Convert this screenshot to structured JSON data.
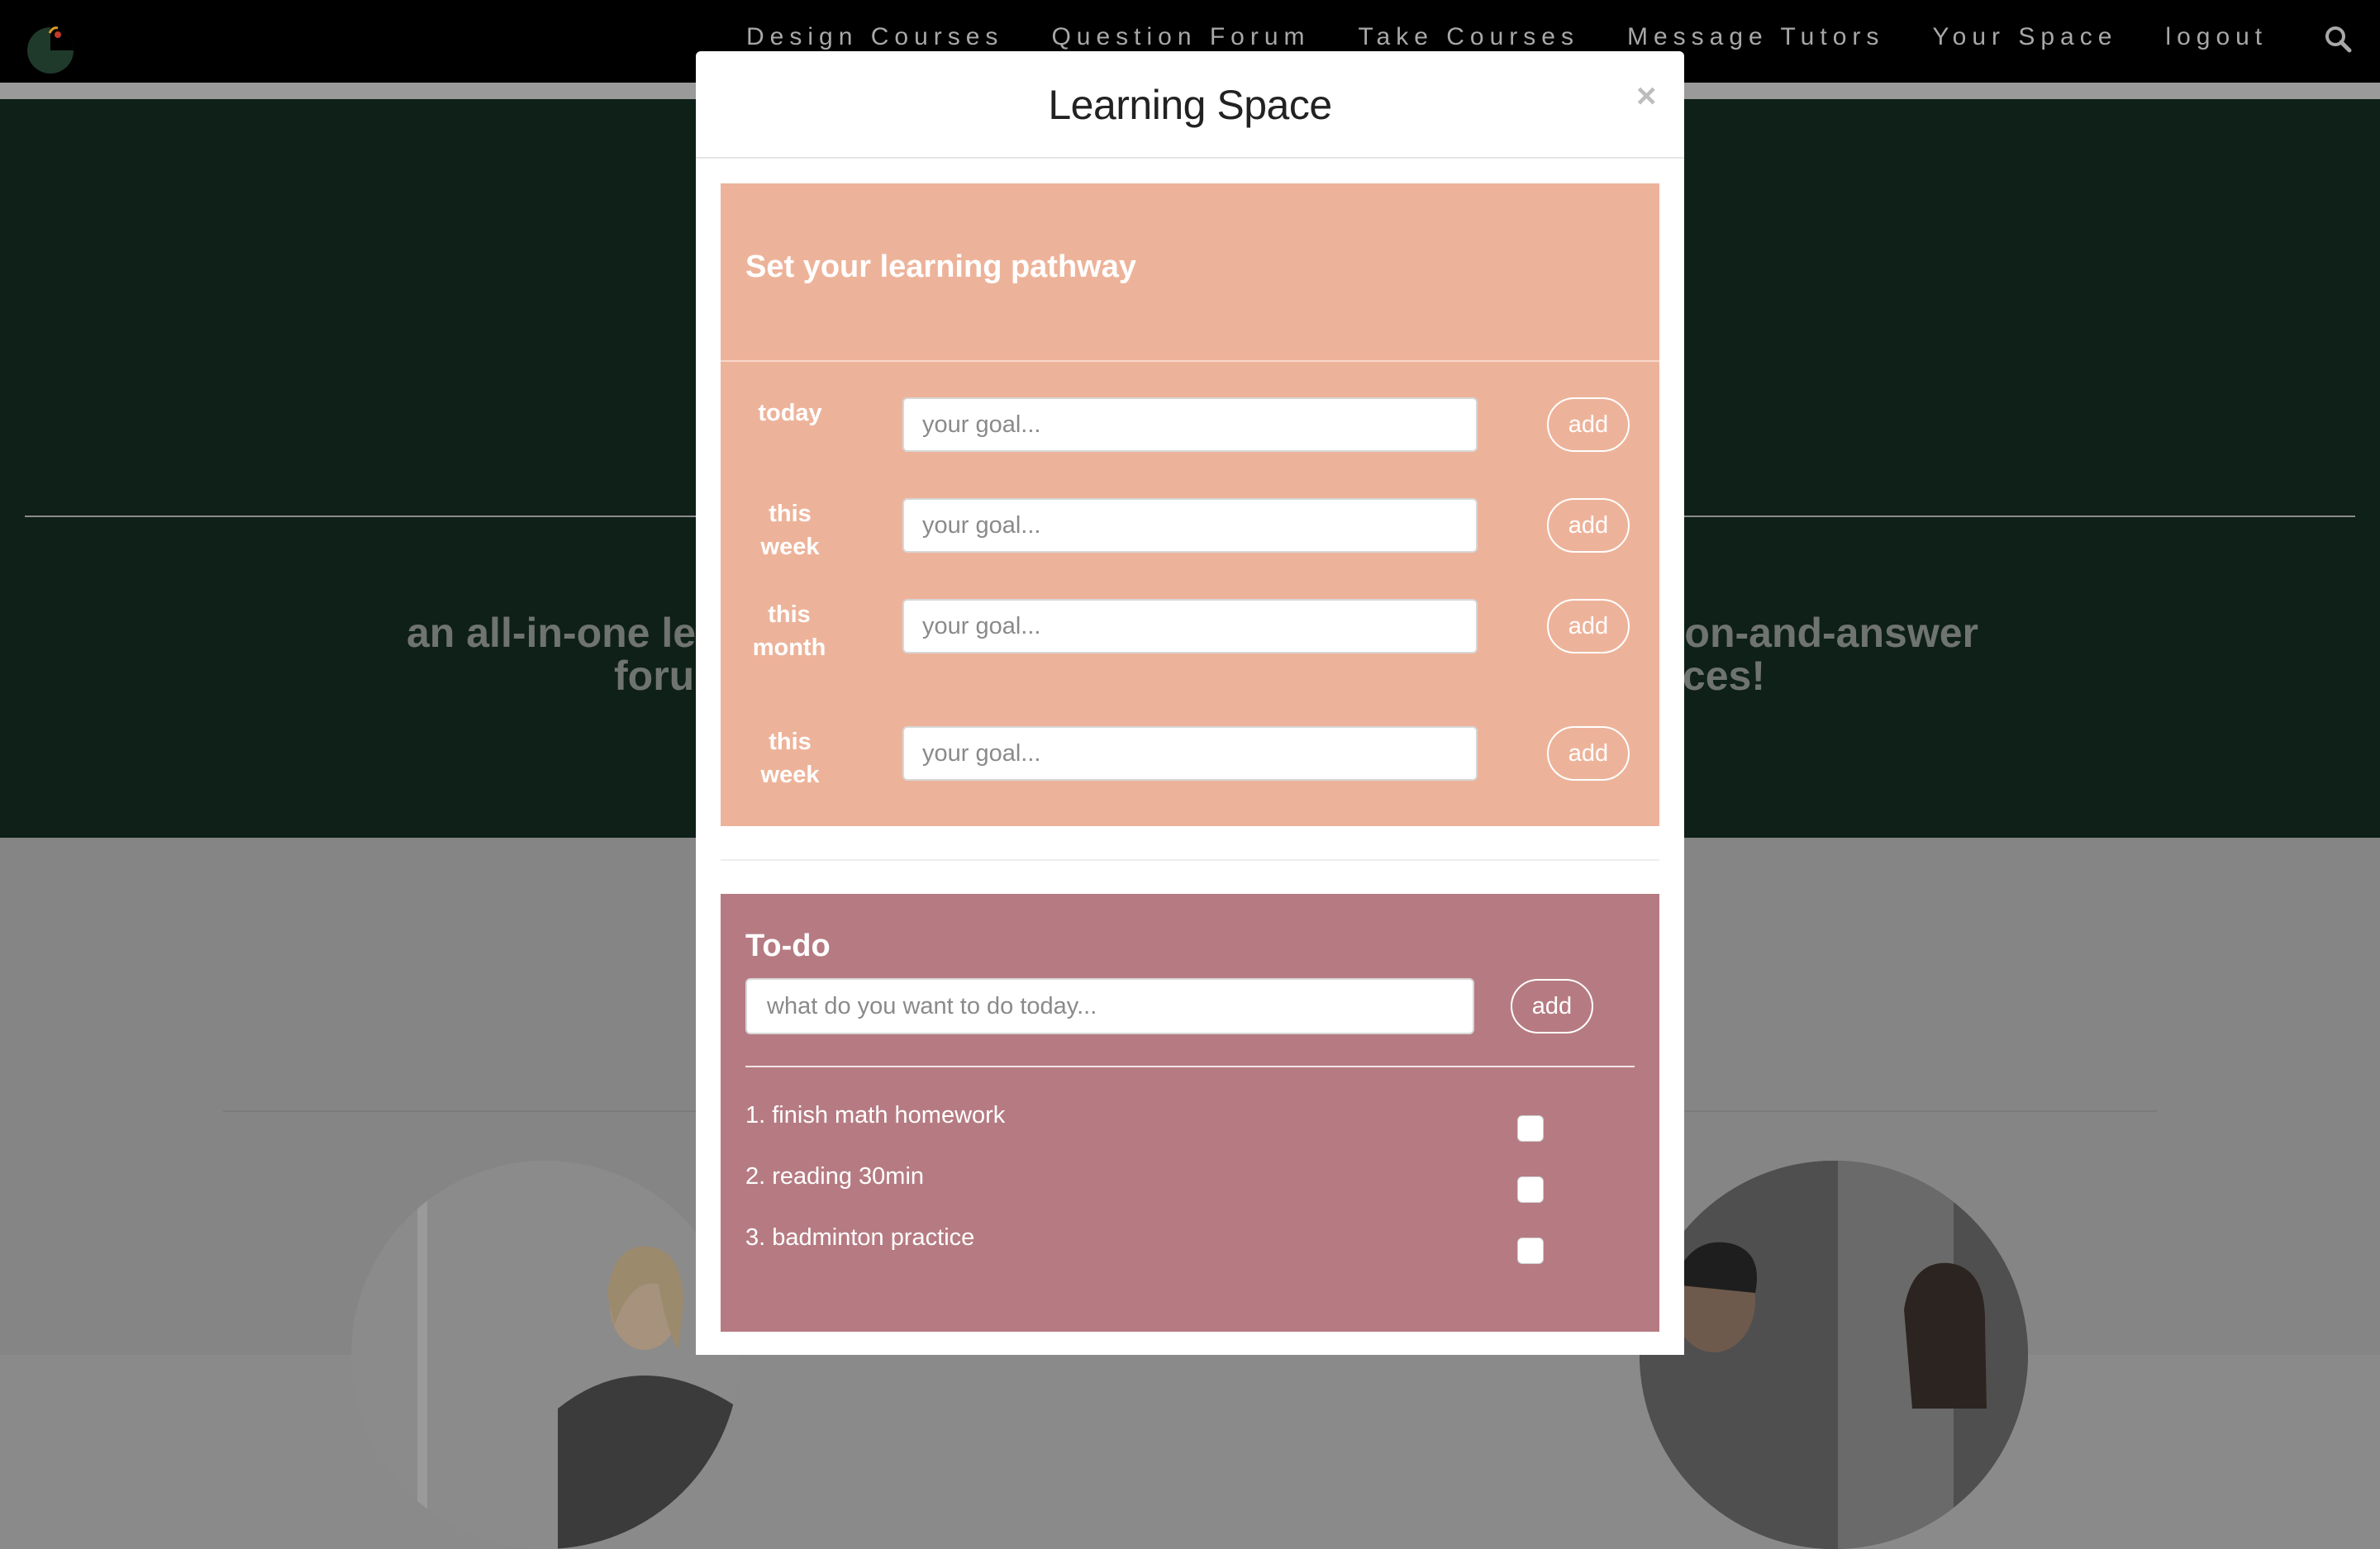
{
  "nav": {
    "items": [
      "Design Courses",
      "Question Forum",
      "Take Courses",
      "Message Tutors",
      "Your Space",
      "logout"
    ],
    "icons": {
      "logo": "app-logo-icon",
      "search": "search-icon"
    }
  },
  "hero": {
    "line1": "an all-in-one lea",
    "line1_right": "ion-and-answer",
    "line2": "foru",
    "line2_right": "ices!"
  },
  "modal": {
    "title": "Learning Space",
    "close": "×"
  },
  "pathway": {
    "title": "Set your learning pathway",
    "goals": [
      {
        "label": "today",
        "placeholder": "your goal...",
        "button": "add"
      },
      {
        "label": "this week",
        "placeholder": "your goal...",
        "button": "add"
      },
      {
        "label": "this month",
        "placeholder": "your goal...",
        "button": "add"
      },
      {
        "label": "this week",
        "placeholder": "your goal...",
        "button": "add"
      }
    ]
  },
  "todo": {
    "title": "To-do",
    "placeholder": "what do you want to do today...",
    "button": "add",
    "items": [
      {
        "text": "1. finish math homework",
        "checked": false
      },
      {
        "text": "2. reading 30min",
        "checked": false
      },
      {
        "text": "3. badminton practice",
        "checked": false
      }
    ]
  },
  "colors": {
    "navbar": "#000000",
    "hero": "#0e2018",
    "pathway": "#edb39a",
    "todo": "#b67b82"
  }
}
